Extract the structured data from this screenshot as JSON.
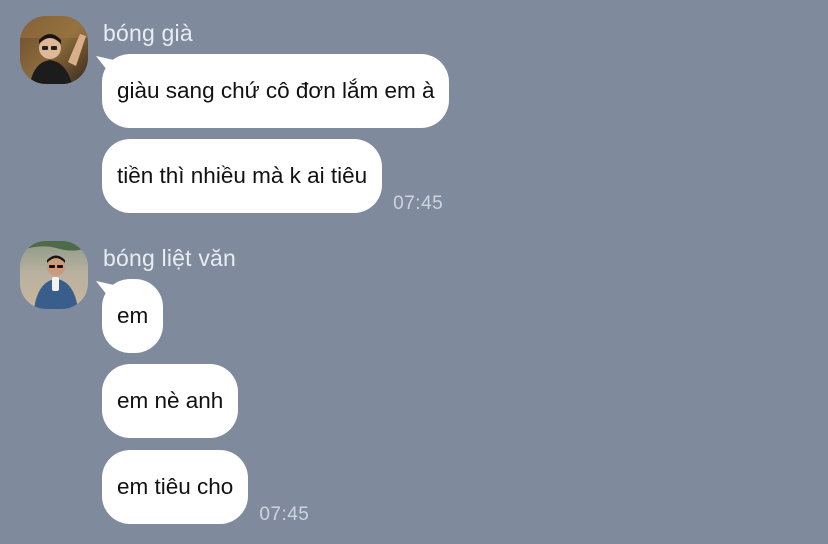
{
  "chat": {
    "groups": [
      {
        "sender_name": "bóng già",
        "avatar_icon": "user-avatar-photo",
        "messages": [
          {
            "text": "giàu sang chứ cô đơn lắm em à"
          },
          {
            "text": "tiền thì nhiều mà k ai tiêu",
            "time": "07:45"
          }
        ]
      },
      {
        "sender_name": "bóng liệt văn",
        "avatar_icon": "user-avatar-photo",
        "messages": [
          {
            "text": "em"
          },
          {
            "text": "em nè anh"
          },
          {
            "text": "em tiêu cho",
            "time": "07:45"
          }
        ]
      }
    ]
  },
  "colors": {
    "background": "#7f8a9d",
    "bubble": "#ffffff",
    "sender_name": "#e8ecf3",
    "timestamp": "#cfd5df"
  }
}
